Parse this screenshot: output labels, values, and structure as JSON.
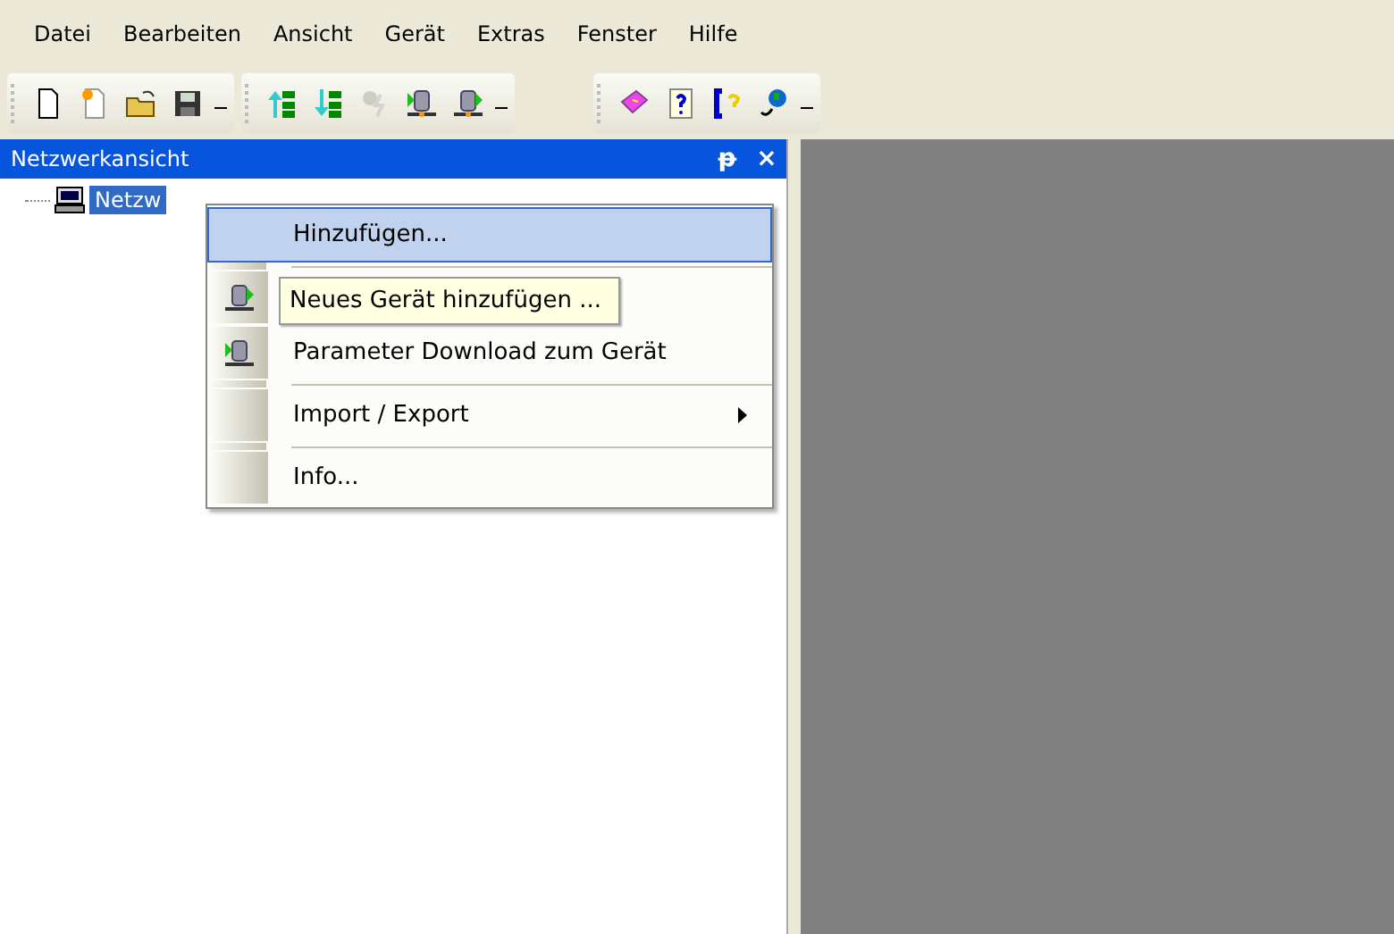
{
  "menu_bar": [
    "Datei",
    "Bearbeiten",
    "Ansicht",
    "Gerät",
    "Extras",
    "Fenster",
    "Hilfe"
  ],
  "toolbars": [
    {
      "buttons": [
        {
          "kind": "new",
          "disabled": false
        },
        {
          "kind": "new-star",
          "disabled": false
        },
        {
          "kind": "open",
          "disabled": false
        },
        {
          "kind": "save",
          "disabled": false
        }
      ]
    },
    {
      "buttons": [
        {
          "kind": "tree-up",
          "disabled": false
        },
        {
          "kind": "tree-down",
          "disabled": false
        },
        {
          "kind": "plug",
          "disabled": true
        },
        {
          "kind": "device-in",
          "disabled": false
        },
        {
          "kind": "device-out",
          "disabled": false
        }
      ]
    },
    {
      "buttons": [
        {
          "kind": "book",
          "disabled": false
        },
        {
          "kind": "help",
          "disabled": false
        },
        {
          "kind": "phone-help",
          "disabled": false
        },
        {
          "kind": "globe",
          "disabled": false
        }
      ]
    }
  ],
  "panel": {
    "title": "Netzwerkansicht",
    "pin": "ᵽ",
    "close": "×",
    "tree": [
      {
        "label": "Netzw",
        "selected": true
      }
    ]
  },
  "context_menu": {
    "items": [
      {
        "kind": "item",
        "label": "Hinzufügen...",
        "selected": true
      },
      {
        "kind": "separator"
      },
      {
        "kind": "send",
        "selected": false
      },
      {
        "kind": "receive",
        "label": "Parameter Download zum Gerät",
        "selected": false
      },
      {
        "kind": "separator"
      },
      {
        "kind": "submenu",
        "label": "Import / Export",
        "selected": false
      },
      {
        "kind": "separator"
      },
      {
        "kind": "item",
        "label": "Info...",
        "selected": false
      }
    ],
    "tooltip": "Neues Gerät hinzufügen ..."
  }
}
